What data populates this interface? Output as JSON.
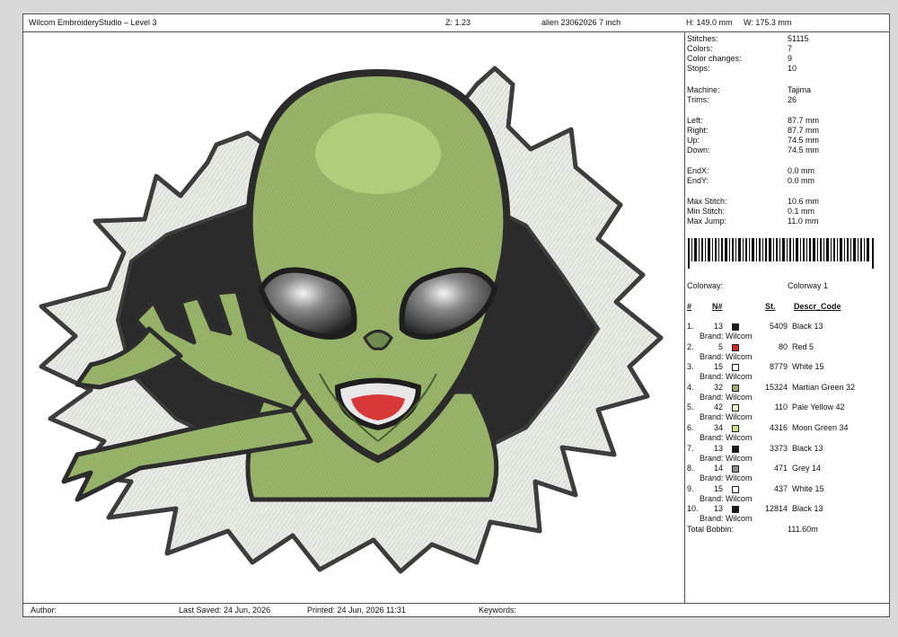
{
  "header": {
    "app_title": "Wilcom EmbroideryStudio – Level 3",
    "zoom": "Z: 1.23",
    "design_name": "alien 23062026 7 inch",
    "height": "H: 149.0 mm",
    "width": "W: 175.3 mm"
  },
  "stats": [
    {
      "label": "Stitches:",
      "value": "51115"
    },
    {
      "label": "Colors:",
      "value": "7"
    },
    {
      "label": "Color changes:",
      "value": "9"
    },
    {
      "label": "Stops:",
      "value": "10"
    },
    {
      "label": "Machine:",
      "value": "Tajima"
    },
    {
      "label": "Trims:",
      "value": "26"
    },
    {
      "label": "Left:",
      "value": "87.7 mm"
    },
    {
      "label": "Right:",
      "value": "87.7 mm"
    },
    {
      "label": "Up:",
      "value": "74.5 mm"
    },
    {
      "label": "Down:",
      "value": "74.5 mm"
    },
    {
      "label": "EndX:",
      "value": "0.0 mm"
    },
    {
      "label": "EndY:",
      "value": "0.0 mm"
    },
    {
      "label": "Max Stitch:",
      "value": "10.6 mm"
    },
    {
      "label": "Min Stitch:",
      "value": "0.1 mm"
    },
    {
      "label": "Max Jump:",
      "value": "11.0 mm"
    }
  ],
  "colorway": {
    "label": "Colorway:",
    "value": "Colorway 1"
  },
  "table_headers": {
    "num": "#",
    "code": "N#",
    "stitches": "St.",
    "descr": "Descr_Code"
  },
  "colors": [
    {
      "idx": "1.",
      "code": "13",
      "hex": "#1a1a1a",
      "stitches": "5409",
      "name": "Black 13",
      "brand": "Brand: Wilcom"
    },
    {
      "idx": "2.",
      "code": "5",
      "hex": "#cc2a2a",
      "stitches": "80",
      "name": "Red 5",
      "brand": "Brand: Wilcom"
    },
    {
      "idx": "3.",
      "code": "15",
      "hex": "#ffffff",
      "stitches": "8779",
      "name": "White 15",
      "brand": "Brand: Wilcom"
    },
    {
      "idx": "4.",
      "code": "32",
      "hex": "#9aae73",
      "stitches": "15324",
      "name": "Martian Green 32",
      "brand": "Brand: Wilcom"
    },
    {
      "idx": "5.",
      "code": "42",
      "hex": "#f5f3c9",
      "stitches": "110",
      "name": "Pale Yellow 42",
      "brand": "Brand: Wilcom"
    },
    {
      "idx": "6.",
      "code": "34",
      "hex": "#c9e38c",
      "stitches": "4316",
      "name": "Moon Green 34",
      "brand": "Brand: Wilcom"
    },
    {
      "idx": "7.",
      "code": "13",
      "hex": "#1a1a1a",
      "stitches": "3373",
      "name": "Black 13",
      "brand": "Brand: Wilcom"
    },
    {
      "idx": "8.",
      "code": "14",
      "hex": "#8c8c8c",
      "stitches": "471",
      "name": "Grey 14",
      "brand": "Brand: Wilcom"
    },
    {
      "idx": "9.",
      "code": "15",
      "hex": "#ffffff",
      "stitches": "437",
      "name": "White 15",
      "brand": "Brand: Wilcom"
    },
    {
      "idx": "10.",
      "code": "13",
      "hex": "#1a1a1a",
      "stitches": "12814",
      "name": "Black 13",
      "brand": "Brand: Wilcom"
    }
  ],
  "total_bobbin": {
    "label": "Total Bobbin:",
    "value": "111.60m"
  },
  "footer": {
    "author": "Author:",
    "last_saved": "Last Saved: 24 Jun, 2026",
    "printed": "Printed: 24 Jun, 2026 11:31",
    "keywords": "Keywords:"
  }
}
